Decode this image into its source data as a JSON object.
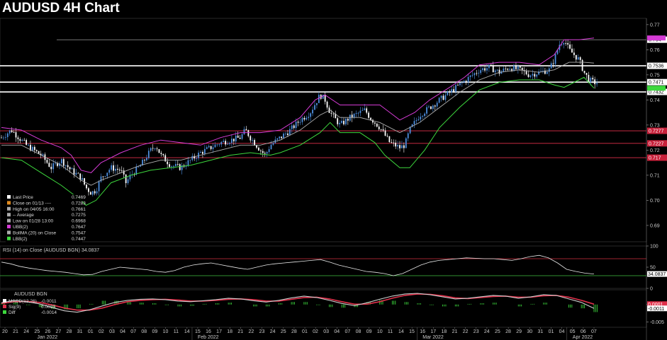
{
  "title": "AUDUSD 4H Chart",
  "colors": {
    "background": "#000000",
    "up_candle": "#4d8fe0",
    "down_candle": "#ffffff",
    "upper_band": "#d63bd6",
    "middle_band": "#b0b0b0",
    "lower_band": "#3dd83d",
    "level_white": "#ffffff",
    "level_red": "#e0304a",
    "rsi_line": "#e8e8e8",
    "rsi_upper": "#d23040",
    "rsi_lower": "#3fbf3f",
    "macd_line": "#ffffff",
    "signal_line": "#e0304a",
    "diff_bars": "#3dd83d"
  },
  "chart_data": [
    {
      "type": "candlestick",
      "panel": "price",
      "ylim": [
        0.6835,
        0.7725
      ],
      "yticks": [
        "0.77",
        "0.76",
        "0.75",
        "0.74",
        "0.73",
        "0.72",
        "0.71",
        "0.70",
        "0.69"
      ],
      "ytick_values": [
        0.77,
        0.76,
        0.75,
        0.74,
        0.73,
        0.72,
        0.71,
        0.7,
        0.69
      ],
      "horizontal_levels": [
        {
          "value": 0.764,
          "label": "0.764",
          "color": "#b8b8b8",
          "kind": "thin"
        },
        {
          "value": 0.7536,
          "label": "0.7536",
          "color": "#ffffff",
          "kind": "thick"
        },
        {
          "value": 0.7471,
          "label": "0.7471",
          "color": "#ffffff",
          "kind": "thick"
        },
        {
          "value": 0.7432,
          "label": "0.7432",
          "color": "#ffffff",
          "kind": "thick"
        },
        {
          "value": 0.7277,
          "label": "0.7277",
          "color": "#e0304a",
          "kind": "red"
        },
        {
          "value": 0.7227,
          "label": "0.7227",
          "color": "#e0304a",
          "kind": "red"
        },
        {
          "value": 0.717,
          "label": "0.717",
          "color": "#e0304a",
          "kind": "red"
        }
      ],
      "band_labels": [
        {
          "value": 0.7647,
          "color": "#d63bd6"
        },
        {
          "value": 0.7447,
          "color": "#3dd83d"
        }
      ],
      "close_path": [
        [
          0,
          0.725
        ],
        [
          2,
          0.728
        ],
        [
          5,
          0.722
        ],
        [
          8,
          0.718
        ],
        [
          10,
          0.713
        ],
        [
          12,
          0.716
        ],
        [
          14,
          0.712
        ],
        [
          16,
          0.709
        ],
        [
          17,
          0.705
        ],
        [
          18,
          0.703
        ],
        [
          19,
          0.704
        ],
        [
          20,
          0.709
        ],
        [
          22,
          0.713
        ],
        [
          24,
          0.712
        ],
        [
          25,
          0.707
        ],
        [
          26,
          0.71
        ],
        [
          28,
          0.714
        ],
        [
          30,
          0.72
        ],
        [
          31,
          0.722
        ],
        [
          32,
          0.718
        ],
        [
          34,
          0.714
        ],
        [
          36,
          0.713
        ],
        [
          38,
          0.716
        ],
        [
          40,
          0.719
        ],
        [
          42,
          0.721
        ],
        [
          44,
          0.723
        ],
        [
          46,
          0.724
        ],
        [
          48,
          0.725
        ],
        [
          49,
          0.728
        ],
        [
          50,
          0.725
        ],
        [
          52,
          0.72
        ],
        [
          53,
          0.718
        ],
        [
          54,
          0.722
        ],
        [
          56,
          0.725
        ],
        [
          58,
          0.728
        ],
        [
          60,
          0.732
        ],
        [
          62,
          0.735
        ],
        [
          64,
          0.742
        ],
        [
          65,
          0.74
        ],
        [
          66,
          0.735
        ],
        [
          68,
          0.73
        ],
        [
          70,
          0.733
        ],
        [
          72,
          0.735
        ],
        [
          73,
          0.736
        ],
        [
          74,
          0.733
        ],
        [
          76,
          0.729
        ],
        [
          78,
          0.723
        ],
        [
          80,
          0.721
        ],
        [
          81,
          0.722
        ],
        [
          82,
          0.728
        ],
        [
          84,
          0.734
        ],
        [
          86,
          0.737
        ],
        [
          88,
          0.74
        ],
        [
          90,
          0.743
        ],
        [
          92,
          0.746
        ],
        [
          94,
          0.749
        ],
        [
          96,
          0.752
        ],
        [
          98,
          0.753
        ],
        [
          100,
          0.751
        ],
        [
          102,
          0.753
        ],
        [
          104,
          0.752
        ],
        [
          106,
          0.75
        ],
        [
          108,
          0.751
        ],
        [
          110,
          0.752
        ],
        [
          111,
          0.756
        ],
        [
          112,
          0.762
        ],
        [
          113,
          0.764
        ],
        [
          114,
          0.76
        ],
        [
          115,
          0.758
        ],
        [
          116,
          0.756
        ],
        [
          117,
          0.751
        ],
        [
          118,
          0.748
        ],
        [
          119,
          0.7469
        ]
      ],
      "upper_band_path": [
        [
          0,
          0.729
        ],
        [
          4,
          0.728
        ],
        [
          8,
          0.724
        ],
        [
          12,
          0.721
        ],
        [
          14,
          0.718
        ],
        [
          16,
          0.712
        ],
        [
          18,
          0.711
        ],
        [
          20,
          0.715
        ],
        [
          24,
          0.719
        ],
        [
          28,
          0.722
        ],
        [
          32,
          0.724
        ],
        [
          36,
          0.723
        ],
        [
          40,
          0.722
        ],
        [
          44,
          0.725
        ],
        [
          48,
          0.727
        ],
        [
          52,
          0.727
        ],
        [
          56,
          0.728
        ],
        [
          60,
          0.733
        ],
        [
          63,
          0.74
        ],
        [
          65,
          0.742
        ],
        [
          68,
          0.738
        ],
        [
          72,
          0.738
        ],
        [
          76,
          0.738
        ],
        [
          78,
          0.735
        ],
        [
          80,
          0.732
        ],
        [
          83,
          0.735
        ],
        [
          86,
          0.74
        ],
        [
          90,
          0.745
        ],
        [
          93,
          0.749
        ],
        [
          96,
          0.754
        ],
        [
          100,
          0.755
        ],
        [
          104,
          0.755
        ],
        [
          108,
          0.754
        ],
        [
          111,
          0.758
        ],
        [
          113,
          0.764
        ],
        [
          116,
          0.764
        ],
        [
          119,
          0.7647
        ]
      ],
      "middle_band_path": [
        [
          0,
          0.722
        ],
        [
          4,
          0.722
        ],
        [
          8,
          0.718
        ],
        [
          12,
          0.714
        ],
        [
          16,
          0.708
        ],
        [
          18,
          0.706
        ],
        [
          20,
          0.708
        ],
        [
          24,
          0.711
        ],
        [
          28,
          0.714
        ],
        [
          32,
          0.716
        ],
        [
          36,
          0.716
        ],
        [
          40,
          0.718
        ],
        [
          44,
          0.72
        ],
        [
          48,
          0.722
        ],
        [
          52,
          0.722
        ],
        [
          56,
          0.724
        ],
        [
          60,
          0.728
        ],
        [
          64,
          0.734
        ],
        [
          66,
          0.736
        ],
        [
          68,
          0.733
        ],
        [
          72,
          0.733
        ],
        [
          76,
          0.731
        ],
        [
          80,
          0.727
        ],
        [
          84,
          0.731
        ],
        [
          88,
          0.737
        ],
        [
          92,
          0.743
        ],
        [
          96,
          0.748
        ],
        [
          100,
          0.751
        ],
        [
          104,
          0.752
        ],
        [
          108,
          0.751
        ],
        [
          111,
          0.752
        ],
        [
          114,
          0.755
        ],
        [
          117,
          0.755
        ],
        [
          119,
          0.7547
        ]
      ],
      "lower_band_path": [
        [
          0,
          0.717
        ],
        [
          4,
          0.716
        ],
        [
          8,
          0.711
        ],
        [
          12,
          0.706
        ],
        [
          16,
          0.7
        ],
        [
          17,
          0.698
        ],
        [
          19,
          0.7
        ],
        [
          22,
          0.707
        ],
        [
          26,
          0.71
        ],
        [
          30,
          0.712
        ],
        [
          34,
          0.713
        ],
        [
          38,
          0.714
        ],
        [
          42,
          0.716
        ],
        [
          46,
          0.718
        ],
        [
          50,
          0.719
        ],
        [
          54,
          0.718
        ],
        [
          56,
          0.719
        ],
        [
          60,
          0.722
        ],
        [
          64,
          0.727
        ],
        [
          66,
          0.731
        ],
        [
          68,
          0.727
        ],
        [
          72,
          0.727
        ],
        [
          75,
          0.723
        ],
        [
          77,
          0.718
        ],
        [
          80,
          0.713
        ],
        [
          82,
          0.713
        ],
        [
          85,
          0.72
        ],
        [
          88,
          0.729
        ],
        [
          92,
          0.737
        ],
        [
          96,
          0.744
        ],
        [
          100,
          0.747
        ],
        [
          104,
          0.748
        ],
        [
          108,
          0.748
        ],
        [
          111,
          0.746
        ],
        [
          113,
          0.745
        ],
        [
          115,
          0.747
        ],
        [
          117,
          0.749
        ],
        [
          119,
          0.7447
        ]
      ]
    },
    {
      "type": "line",
      "panel": "rsi",
      "title": "RSI (14)  on Close (AUDUSD BGN) 34.0837",
      "ylim": [
        0,
        100
      ],
      "yticks": [
        "100",
        "50",
        "0"
      ],
      "ytick_values": [
        100,
        50,
        0
      ],
      "upper_level": 70,
      "lower_level": 30,
      "last_value_label": "34.0837",
      "values": [
        62,
        58,
        52,
        48,
        45,
        42,
        40,
        38,
        35,
        32,
        33,
        40,
        45,
        50,
        48,
        46,
        44,
        40,
        38,
        42,
        50,
        55,
        58,
        60,
        56,
        52,
        48,
        45,
        50,
        55,
        58,
        60,
        62,
        64,
        66,
        68,
        62,
        55,
        50,
        45,
        40,
        38,
        35,
        30,
        35,
        45,
        55,
        62,
        66,
        68,
        70,
        72,
        71,
        70,
        70,
        68,
        66,
        70,
        75,
        78,
        72,
        60,
        45,
        40,
        36,
        34
      ]
    },
    {
      "type": "line",
      "panel": "macd",
      "title": "AUDUSD BGN",
      "ylim": [
        -0.0065,
        0.0042
      ],
      "yticks": [
        "0.000",
        "-0.005"
      ],
      "ytick_values": [
        0.0,
        -0.005
      ],
      "right_labels": [
        {
          "value": 0.0001,
          "label": "0.0001",
          "color": "#e0304a"
        },
        {
          "value": -0.0011,
          "label": "-0.0011",
          "color": "#ffffff"
        }
      ],
      "macd_values": [
        0.0005,
        0.0012,
        0.0008,
        0.0002,
        -0.0008,
        -0.0018,
        -0.0022,
        -0.0015,
        -0.0004,
        0.0006,
        0.0012,
        0.0015,
        0.0016,
        0.0014,
        0.001,
        0.0008,
        0.0011,
        0.0014,
        0.0018,
        0.0016,
        0.0011,
        0.0007,
        0.0012,
        0.0019,
        0.0024,
        0.002,
        0.0012,
        0.0003,
        -0.0003,
        0.0005,
        0.0015,
        0.0024,
        0.003,
        0.0032,
        0.0028,
        0.0022,
        0.0016,
        0.0018,
        0.0022,
        0.0026,
        0.0024,
        0.0018,
        0.0022,
        0.0028,
        0.0026,
        0.0016,
        0.0006,
        -0.0011
      ],
      "signal_values": [
        0.0003,
        0.0008,
        0.0009,
        0.0006,
        -0.0001,
        -0.001,
        -0.0016,
        -0.0016,
        -0.001,
        0.0,
        0.0008,
        0.0012,
        0.0014,
        0.0015,
        0.0013,
        0.001,
        0.001,
        0.0012,
        0.0015,
        0.0016,
        0.0014,
        0.001,
        0.001,
        0.0015,
        0.002,
        0.0021,
        0.0016,
        0.0008,
        0.0001,
        0.0001,
        0.0008,
        0.0018,
        0.0026,
        0.003,
        0.0029,
        0.0025,
        0.0019,
        0.0017,
        0.002,
        0.0023,
        0.0024,
        0.0021,
        0.0021,
        0.0025,
        0.0026,
        0.0021,
        0.0012,
        0.0001
      ]
    }
  ],
  "legend": [
    {
      "color": "#ffffff",
      "label": "Last Price",
      "value": "0.7469"
    },
    {
      "color": "#e08a1e",
      "label": "Close on 01/13 ----",
      "value": "0.7283"
    },
    {
      "color": "#aaaaaa",
      "label": "High on 04/05 16:00",
      "value": "0.7661"
    },
    {
      "color": "#aaaaaa",
      "label": "-- Average",
      "value": "0.7275"
    },
    {
      "color": "#aaaaaa",
      "label": "Low on 01/28 13:00",
      "value": "0.6968"
    },
    {
      "color": "#d63bd6",
      "label": "UBB(2)",
      "value": "0.7647"
    },
    {
      "color": "#aaaaaa",
      "label": "BollMA (20)  on Close",
      "value": "0.7547"
    },
    {
      "color": "#3dd83d",
      "label": "LBB(2)",
      "value": "0.7447"
    }
  ],
  "macd_legend": [
    {
      "color": "#ffffff",
      "label": "MACD(12,26)",
      "value": "-0.0011"
    },
    {
      "color": "#e0304a",
      "label": "Sig(9)",
      "value": "0.0003"
    },
    {
      "color": "#3dd83d",
      "label": "Diff",
      "value": "-0.0014"
    }
  ],
  "x_axis": {
    "day_labels": [
      "20",
      "21",
      "24",
      "25",
      "26",
      "27",
      "28",
      "31",
      "01",
      "02",
      "03",
      "04",
      "07",
      "08",
      "09",
      "10",
      "11",
      "14",
      "15",
      "16",
      "17",
      "18",
      "21",
      "22",
      "23",
      "24",
      "25",
      "28",
      "01",
      "02",
      "03",
      "04",
      "07",
      "08",
      "09",
      "10",
      "11",
      "14",
      "15",
      "16",
      "17",
      "18",
      "21",
      "22",
      "23",
      "24",
      "25",
      "28",
      "29",
      "30",
      "31",
      "01",
      "04",
      "05",
      "06",
      "07"
    ],
    "month_labels": [
      {
        "label": "Jan 2022",
        "at_index": 3
      },
      {
        "label": "Feb 2022",
        "at_index": 18
      },
      {
        "label": "Mar 2022",
        "at_index": 39
      },
      {
        "label": "Apr 2022",
        "at_index": 53
      }
    ]
  }
}
